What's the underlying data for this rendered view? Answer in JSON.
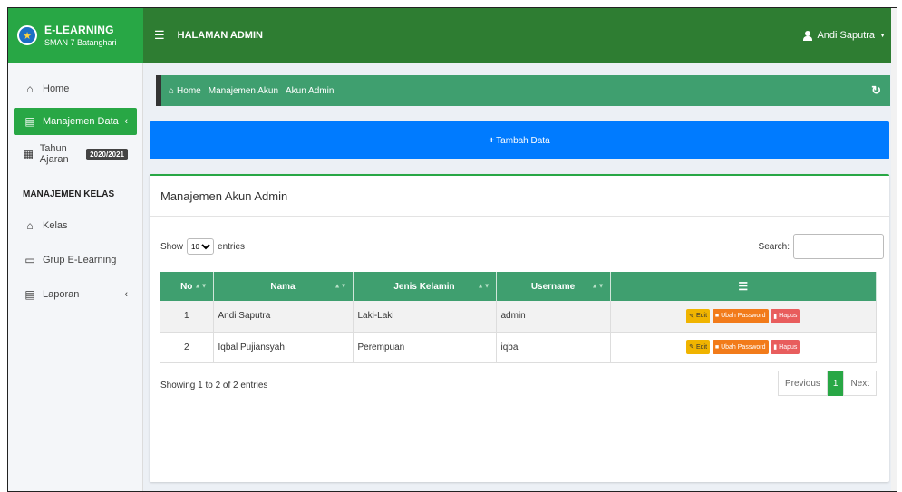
{
  "brand": {
    "name": "E-LEARNING",
    "school": "SMAN 7 Batanghari"
  },
  "topbar": {
    "title": "HALAMAN ADMIN",
    "user": "Andi Saputra"
  },
  "sidebar": {
    "items": [
      {
        "label": "Home"
      },
      {
        "label": "Manajemen Data"
      },
      {
        "label": "Tahun Ajaran",
        "badge": "2020/2021"
      }
    ],
    "section": "MANAJEMEN KELAS",
    "class_items": [
      {
        "label": "Kelas"
      },
      {
        "label": "Grup E-Learning"
      },
      {
        "label": "Laporan"
      }
    ]
  },
  "breadcrumb": [
    "Home",
    "Manajemen Akun",
    "Akun Admin"
  ],
  "add_button": "Tambah Data",
  "card": {
    "title": "Manajemen Akun Admin"
  },
  "controls": {
    "show": "Show",
    "entries_value": "10",
    "entries": "entries",
    "search": "Search:"
  },
  "table": {
    "headers": [
      "No",
      "Nama",
      "Jenis Kelamin",
      "Username"
    ],
    "rows": [
      {
        "no": "1",
        "nama": "Andi Saputra",
        "jk": "Laki-Laki",
        "username": "admin"
      },
      {
        "no": "2",
        "nama": "Iqbal Pujiansyah",
        "jk": "Perempuan",
        "username": "iqbal"
      }
    ],
    "actions": {
      "edit": "Edit",
      "password": "Ubah Password",
      "delete": "Hapus"
    }
  },
  "info": "Showing 1 to 2 of 2 entries",
  "pager": {
    "prev": "Previous",
    "current": "1",
    "next": "Next"
  },
  "colors": {
    "green": "#28a745",
    "dark_green": "#2e7d32",
    "teal_green": "#3f9f6f",
    "blue": "#007bff"
  }
}
